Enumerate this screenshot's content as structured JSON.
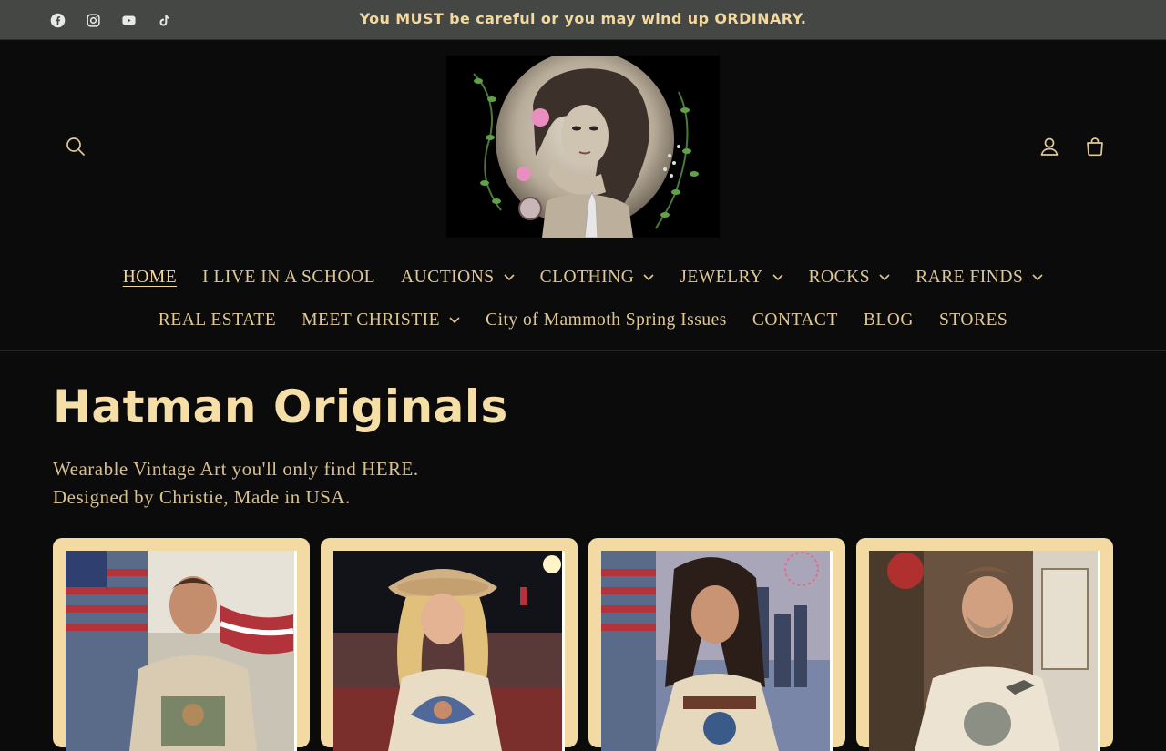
{
  "announcement": {
    "text": "You MUST be careful or you may wind up ORDINARY."
  },
  "socials": [
    {
      "name": "facebook-icon"
    },
    {
      "name": "instagram-icon"
    },
    {
      "name": "youtube-icon"
    },
    {
      "name": "tiktok-icon"
    }
  ],
  "header": {
    "search_icon": "search-icon",
    "account_icon": "account-icon",
    "cart_icon": "cart-icon"
  },
  "nav": {
    "row1": [
      {
        "label": "HOME",
        "active": true,
        "dropdown": false
      },
      {
        "label": "I LIVE IN A SCHOOL",
        "dropdown": false
      },
      {
        "label": "AUCTIONS",
        "dropdown": true
      },
      {
        "label": "CLOTHING",
        "dropdown": true
      },
      {
        "label": "JEWELRY",
        "dropdown": true
      },
      {
        "label": "ROCKS",
        "dropdown": true
      },
      {
        "label": "RARE FINDS",
        "dropdown": true
      }
    ],
    "row2": [
      {
        "label": "REAL ESTATE",
        "dropdown": false
      },
      {
        "label": "MEET CHRISTIE",
        "dropdown": true
      },
      {
        "label": "City of Mammoth Spring Issues",
        "dropdown": false
      },
      {
        "label": "CONTACT",
        "dropdown": false
      },
      {
        "label": "BLOG",
        "dropdown": false
      },
      {
        "label": "STORES",
        "dropdown": false
      }
    ]
  },
  "main": {
    "title": "Hatman Originals",
    "subtitle_line1": "Wearable Vintage Art you'll only find HERE.",
    "subtitle_line2": "Designed by Christie, Made in USA."
  },
  "colors": {
    "announce_bg": "#444744",
    "page_bg": "#0b0b0b",
    "accent": "#f3d9a2"
  }
}
